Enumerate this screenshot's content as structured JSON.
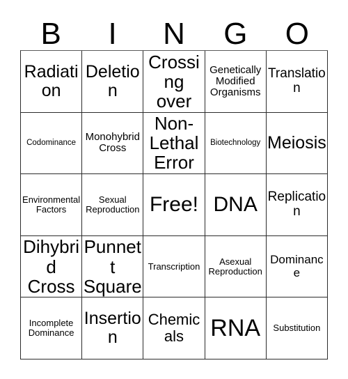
{
  "card": {
    "title": "Bingo Card",
    "header_letters": [
      "B",
      "I",
      "N",
      "G",
      "O"
    ],
    "columns": 5,
    "rows": 5,
    "background_color": "#ffffff",
    "text_color": "#000000",
    "border_color": "#2b2b2b",
    "free_space": {
      "label": "Free!",
      "row": 3,
      "column": 3
    },
    "cells": [
      {
        "row": 1,
        "column": 1,
        "column_letter": "B",
        "text": "Radiation",
        "size": "md",
        "free": false
      },
      {
        "row": 1,
        "column": 2,
        "column_letter": "I",
        "text": "Deletion",
        "size": "md",
        "free": false
      },
      {
        "row": 1,
        "column": 3,
        "column_letter": "N",
        "text": "Crossing over",
        "size": "lg",
        "free": false
      },
      {
        "row": 1,
        "column": 4,
        "column_letter": "G",
        "text": "Genetically Modified Organisms",
        "size": "xxs",
        "free": false
      },
      {
        "row": 1,
        "column": 5,
        "column_letter": "O",
        "text": "Translation",
        "size": "sm",
        "free": false
      },
      {
        "row": 2,
        "column": 1,
        "column_letter": "B",
        "text": "Codominance",
        "size": "mini",
        "free": false
      },
      {
        "row": 2,
        "column": 2,
        "column_letter": "I",
        "text": "Monohybrid Cross",
        "size": "xxs",
        "free": false
      },
      {
        "row": 2,
        "column": 3,
        "column_letter": "N",
        "text": "Non-Lethal Error",
        "size": "lg",
        "free": false
      },
      {
        "row": 2,
        "column": 4,
        "column_letter": "G",
        "text": "Biotechnology",
        "size": "mini",
        "free": false
      },
      {
        "row": 2,
        "column": 5,
        "column_letter": "O",
        "text": "Meiosis",
        "size": "md",
        "free": false
      },
      {
        "row": 3,
        "column": 1,
        "column_letter": "B",
        "text": "Environmental Factors",
        "size": "tiny",
        "free": false
      },
      {
        "row": 3,
        "column": 2,
        "column_letter": "I",
        "text": "Sexual Reproduction",
        "size": "tiny",
        "free": false
      },
      {
        "row": 3,
        "column": 3,
        "column_letter": "N",
        "text": "Free!",
        "size": "xl",
        "free": true
      },
      {
        "row": 3,
        "column": 4,
        "column_letter": "G",
        "text": "DNA",
        "size": "xl",
        "free": false
      },
      {
        "row": 3,
        "column": 5,
        "column_letter": "O",
        "text": "Replication",
        "size": "sm",
        "free": false
      },
      {
        "row": 4,
        "column": 1,
        "column_letter": "B",
        "text": "Dihybrid Cross",
        "size": "lg",
        "free": false
      },
      {
        "row": 4,
        "column": 2,
        "column_letter": "I",
        "text": "Punnett Square",
        "size": "lg",
        "free": false
      },
      {
        "row": 4,
        "column": 3,
        "column_letter": "N",
        "text": "Transcription",
        "size": "tiny",
        "free": false
      },
      {
        "row": 4,
        "column": 4,
        "column_letter": "G",
        "text": "Asexual Reproduction",
        "size": "tiny",
        "free": false
      },
      {
        "row": 4,
        "column": 5,
        "column_letter": "O",
        "text": "Dominance",
        "size": "xs",
        "free": false
      },
      {
        "row": 5,
        "column": 1,
        "column_letter": "B",
        "text": "Incomplete Dominance",
        "size": "tiny",
        "free": false
      },
      {
        "row": 5,
        "column": 2,
        "column_letter": "I",
        "text": "Insertion",
        "size": "md",
        "free": false
      },
      {
        "row": 5,
        "column": 3,
        "column_letter": "N",
        "text": "Chemicals",
        "size": "ml",
        "free": false
      },
      {
        "row": 5,
        "column": 4,
        "column_letter": "G",
        "text": "RNA",
        "size": "xxl",
        "free": false
      },
      {
        "row": 5,
        "column": 5,
        "column_letter": "O",
        "text": "Substitution",
        "size": "tiny",
        "free": false
      }
    ]
  }
}
